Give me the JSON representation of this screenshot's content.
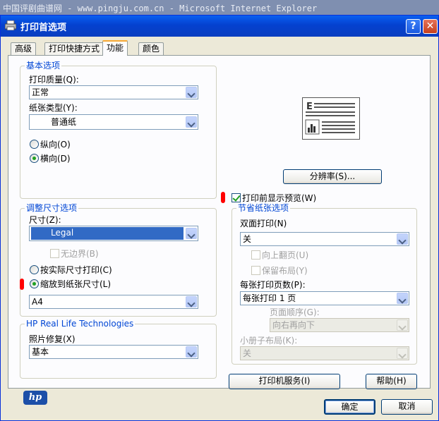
{
  "browser_title": "中国评剧曲谱网 - www.pingju.com.cn - Microsoft Internet Explorer",
  "dialog": {
    "title": "打印首选项",
    "help_glyph": "?",
    "close_glyph": "✕"
  },
  "tabs": [
    {
      "label": "高级"
    },
    {
      "label": "打印快捷方式"
    },
    {
      "label": "功能"
    },
    {
      "label": "颜色"
    }
  ],
  "basic": {
    "legend": "基本选项",
    "quality_label": "打印质量(Q):",
    "quality_value": "正常",
    "paper_type_label": "纸张类型(Y):",
    "paper_type_value": "普通纸",
    "portrait_label": "纵向(O)",
    "landscape_label": "横向(D)"
  },
  "preview": {
    "letter": "E"
  },
  "resolution_button": "分辨率(S)...",
  "show_preview_label": "打印前显示预览(W)",
  "resize": {
    "legend": "调整尺寸选项",
    "size_label": "尺寸(Z):",
    "size_value": "Legal",
    "borderless_label": "无边界(B)",
    "actual_size_label": "按实际尺寸打印(C)",
    "fit_to_paper_label": "缩放到纸张尺寸(L)",
    "fit_paper_value": "A4"
  },
  "hp_real_life": {
    "legend": "HP Real Life Technologies",
    "photo_fix_label": "照片修复(X)",
    "photo_fix_value": "基本"
  },
  "paper_saving": {
    "legend": "节省纸张选项",
    "duplex_label": "双面打印(N)",
    "duplex_value": "关",
    "flip_up_label": "向上翻页(U)",
    "retain_layout_label": "保留布局(Y)",
    "pages_per_sheet_label": "每张打印页数(P):",
    "pages_per_sheet_value": "每张打印 1 页",
    "page_order_label": "页面顺序(G):",
    "page_order_value": "向右再向下",
    "booklet_label": "小册子布局(K):",
    "booklet_value": "关"
  },
  "logo_text": "hp",
  "printer_services_button": "打印机服务(I)",
  "help_button": "帮助(H)",
  "ok_button": "确定",
  "cancel_button": "取消",
  "colors": {
    "legend": "#0046d5",
    "titlebar": "#0a5ff0",
    "selection": "#316ac5",
    "check": "#21a121"
  }
}
